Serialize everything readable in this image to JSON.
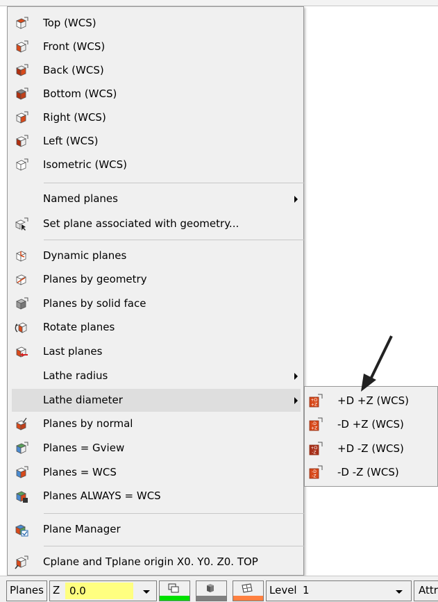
{
  "menu": {
    "items": [
      {
        "label": "Top (WCS)",
        "icon": "cube-top-icon"
      },
      {
        "label": "Front (WCS)",
        "icon": "cube-front-icon"
      },
      {
        "label": "Back (WCS)",
        "icon": "cube-back-icon"
      },
      {
        "label": "Bottom (WCS)",
        "icon": "cube-bottom-icon"
      },
      {
        "label": "Right (WCS)",
        "icon": "cube-right-icon"
      },
      {
        "label": "Left (WCS)",
        "icon": "cube-left-icon"
      },
      {
        "label": "Isometric (WCS)",
        "icon": "cube-isometric-icon"
      },
      {
        "label": "Named planes",
        "submenu": true
      },
      {
        "label": "Set plane associated with geometry...",
        "icon": "plane-geometry-cursor-icon"
      },
      {
        "label": "Dynamic planes",
        "icon": "dynamic-plane-icon"
      },
      {
        "label": "Planes by geometry",
        "icon": "plane-by-geometry-icon"
      },
      {
        "label": "Planes by solid face",
        "icon": "plane-solid-face-icon"
      },
      {
        "label": "Rotate planes",
        "icon": "rotate-plane-icon"
      },
      {
        "label": "Last planes",
        "icon": "last-plane-icon"
      },
      {
        "label": "Lathe radius",
        "submenu": true
      },
      {
        "label": "Lathe diameter",
        "submenu": true,
        "highlighted": true
      },
      {
        "label": "Planes by normal",
        "icon": "plane-normal-icon"
      },
      {
        "label": "Planes = Gview",
        "icon": "plane-gview-icon"
      },
      {
        "label": "Planes = WCS",
        "icon": "plane-wcs-icon"
      },
      {
        "label": "Planes ALWAYS = WCS",
        "icon": "plane-always-wcs-icon"
      },
      {
        "label": "Plane Manager",
        "icon": "plane-manager-icon"
      },
      {
        "label": "Cplane and Tplane origin X0. Y0. Z0.   TOP",
        "icon": "cplane-origin-icon"
      }
    ]
  },
  "submenu": {
    "items": [
      {
        "label": "+D +Z (WCS)",
        "icon": "lathe-plus-d-plus-z-icon"
      },
      {
        "label": "-D +Z (WCS)",
        "icon": "lathe-minus-d-plus-z-icon"
      },
      {
        "label": "+D -Z (WCS)",
        "icon": "lathe-plus-d-minus-z-icon"
      },
      {
        "label": "-D -Z (WCS)",
        "icon": "lathe-minus-d-minus-z-icon"
      }
    ]
  },
  "statusbar": {
    "planes_label": "Planes",
    "z_label": "Z",
    "z_value": "0.0",
    "level_label": "Level",
    "level_value": "1",
    "attributes_label": "Attri",
    "colors": {
      "green": "#00e000",
      "gray": "#808080",
      "orange": "#ff8040"
    }
  }
}
